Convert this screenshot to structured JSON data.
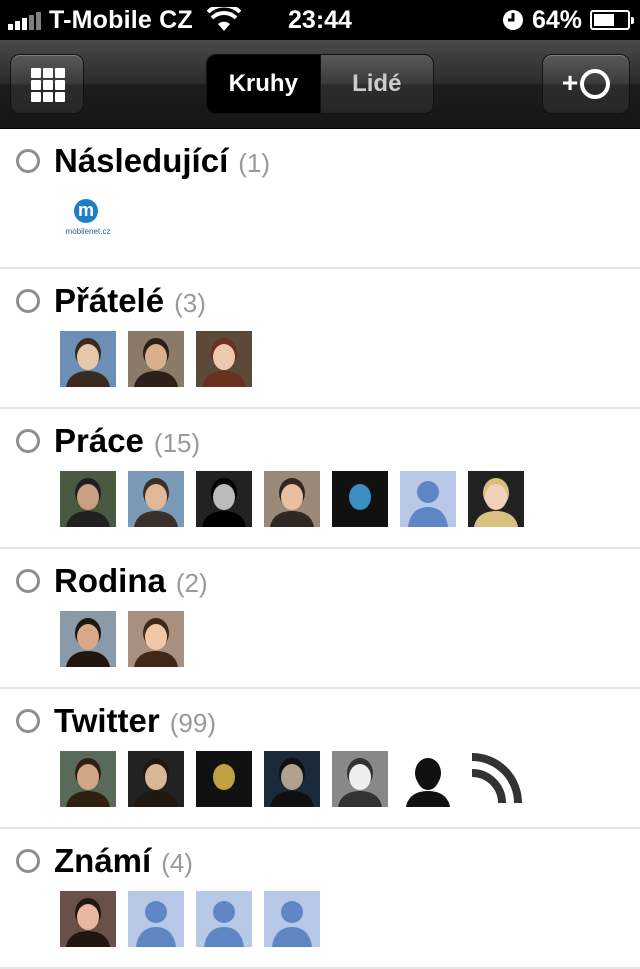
{
  "status": {
    "carrier": "T-Mobile CZ",
    "time": "23:44",
    "battery": "64%",
    "battery_level": 0.64
  },
  "toolbar": {
    "tabs": [
      {
        "label": "Kruhy",
        "active": true
      },
      {
        "label": "Lidé",
        "active": false
      }
    ],
    "add_label": "+"
  },
  "circles": [
    {
      "name": "Následující",
      "count": "(1)",
      "avatars": [
        "logo"
      ]
    },
    {
      "name": "Přátelé",
      "count": "(3)",
      "avatars": [
        "photo-1",
        "photo-2",
        "photo-3"
      ]
    },
    {
      "name": "Práce",
      "count": "(15)",
      "avatars": [
        "photo-4",
        "photo-5",
        "photo-6",
        "photo-7",
        "photo-8",
        "silhouette",
        "photo-9"
      ]
    },
    {
      "name": "Rodina",
      "count": "(2)",
      "avatars": [
        "photo-10",
        "photo-11"
      ]
    },
    {
      "name": "Twitter",
      "count": "(99)",
      "avatars": [
        "photo-12",
        "photo-13",
        "photo-14",
        "photo-15",
        "photo-16",
        "photo-17",
        "rss-icon"
      ]
    },
    {
      "name": "Známí",
      "count": "(4)",
      "avatars": [
        "photo-18",
        "silhouette",
        "silhouette",
        "silhouette"
      ]
    }
  ],
  "logo_text": "mobilenet.cz"
}
